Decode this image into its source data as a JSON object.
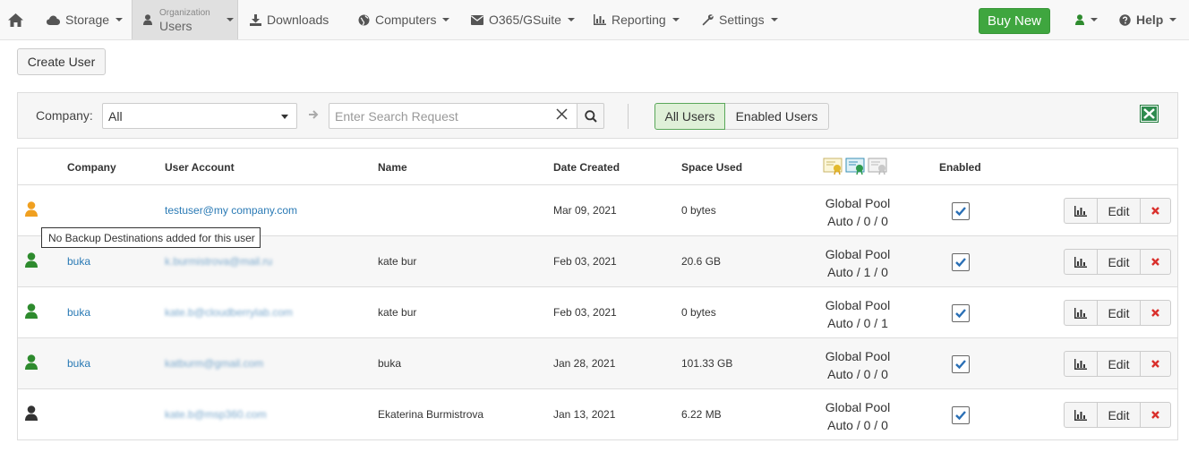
{
  "nav": {
    "storage": "Storage",
    "org_small": "Organization",
    "org_big": "Users",
    "downloads": "Downloads",
    "computers": "Computers",
    "o365": "O365/GSuite",
    "reporting": "Reporting",
    "settings": "Settings",
    "buy_new": "Buy New",
    "help": "Help"
  },
  "toolbar": {
    "create_user": "Create User"
  },
  "filter": {
    "company_label": "Company:",
    "company_value": "All",
    "search_placeholder": "Enter Search Request",
    "all_users": "All Users",
    "enabled_users": "Enabled Users"
  },
  "table": {
    "headers": {
      "company": "Company",
      "user_account": "User Account",
      "name": "Name",
      "date_created": "Date Created",
      "space_used": "Space Used",
      "enabled": "Enabled"
    },
    "rows": [
      {
        "status": "warning",
        "company": "",
        "account": "testuser@my company.com",
        "name": "",
        "date": "Mar 09, 2021",
        "space": "0 bytes",
        "pool": "Global Pool",
        "quota": "Auto / 0 / 0",
        "enabled": true
      },
      {
        "status": "ok",
        "company": "buka",
        "account": "k.burmistrova@mail.ru",
        "name": "kate bur",
        "date": "Feb 03, 2021",
        "space": "20.6 GB",
        "pool": "Global Pool",
        "quota": "Auto / 1 / 0",
        "enabled": true
      },
      {
        "status": "ok",
        "company": "buka",
        "account": "kate.b@cloudberrylab.com",
        "name": "kate bur",
        "date": "Feb 03, 2021",
        "space": "0 bytes",
        "pool": "Global Pool",
        "quota": "Auto / 0 / 1",
        "enabled": true
      },
      {
        "status": "ok",
        "company": "buka",
        "account": "katburm@gmail.com",
        "name": "buka",
        "date": "Jan 28, 2021",
        "space": "101.33 GB",
        "pool": "Global Pool",
        "quota": "Auto / 0 / 0",
        "enabled": true
      },
      {
        "status": "inactive",
        "company": "",
        "account": "kate.b@msp360.com",
        "name": "Ekaterina Burmistrova",
        "date": "Jan 13, 2021",
        "space": "6.22 MB",
        "pool": "Global Pool",
        "quota": "Auto / 0 / 0",
        "enabled": true
      }
    ],
    "edit_label": "Edit"
  },
  "tooltip": "No Backup Destinations added for this user",
  "colors": {
    "accent_green": "#3fa63f",
    "link_blue": "#2a7ab5",
    "warning_orange": "#f0a020",
    "ok_green": "#2e8b2e",
    "inactive_dark": "#333333"
  }
}
